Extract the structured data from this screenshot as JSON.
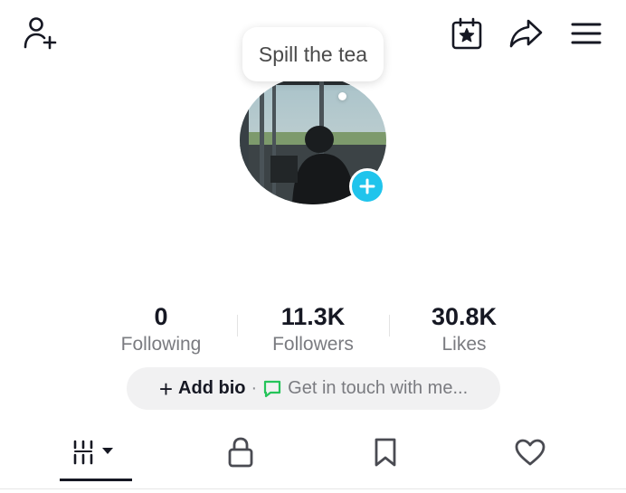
{
  "header": {
    "left_icon": "add-friend-icon",
    "right_icons": [
      "calendar-star-icon",
      "share-icon",
      "menu-icon"
    ]
  },
  "tooltip": {
    "text": "Spill the tea"
  },
  "stats": [
    {
      "value": "0",
      "label": "Following"
    },
    {
      "value": "11.3K",
      "label": "Followers"
    },
    {
      "value": "30.8K",
      "label": "Likes"
    }
  ],
  "bio": {
    "add_label": "Add bio",
    "separator": "·",
    "contact_label": "Get in touch with me..."
  },
  "tabs": [
    {
      "icon": "videos-grid-icon",
      "active": true
    },
    {
      "icon": "lock-icon",
      "active": false
    },
    {
      "icon": "bookmark-icon",
      "active": false
    },
    {
      "icon": "heart-icon",
      "active": false
    }
  ],
  "colors": {
    "accent": "#20c4ec",
    "text_primary": "#161823",
    "text_secondary": "#7a7b80",
    "pill_bg": "#f1f1f2"
  }
}
